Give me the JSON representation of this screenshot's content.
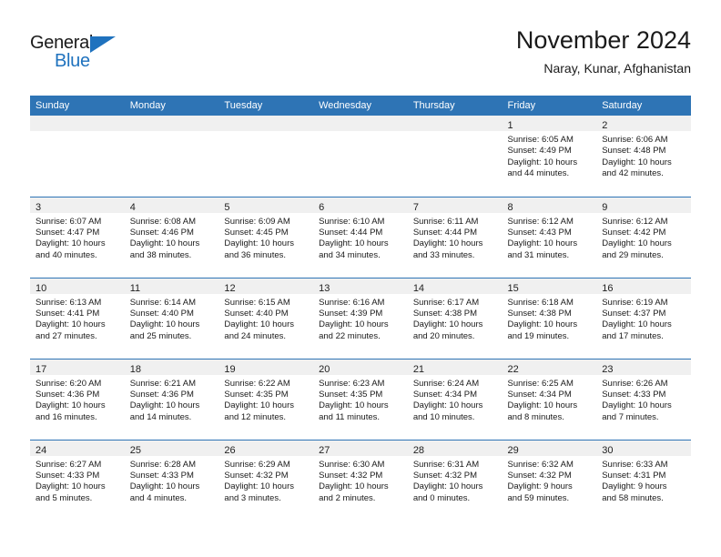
{
  "brand": {
    "name_part1": "General",
    "name_part2": "Blue",
    "accent_color": "#1F72BE",
    "triangle_icon": "triangle-icon"
  },
  "header": {
    "title": "November 2024",
    "subtitle": "Naray, Kunar, Afghanistan"
  },
  "theme": {
    "header_blue": "#2E74B5",
    "daynum_strip_gray": "#F0F0F0"
  },
  "weekday_headers": [
    "Sunday",
    "Monday",
    "Tuesday",
    "Wednesday",
    "Thursday",
    "Friday",
    "Saturday"
  ],
  "weeks": [
    [
      {
        "day": "",
        "lines": []
      },
      {
        "day": "",
        "lines": []
      },
      {
        "day": "",
        "lines": []
      },
      {
        "day": "",
        "lines": []
      },
      {
        "day": "",
        "lines": []
      },
      {
        "day": "1",
        "lines": [
          "Sunrise: 6:05 AM",
          "Sunset: 4:49 PM",
          "Daylight: 10 hours",
          "and 44 minutes."
        ]
      },
      {
        "day": "2",
        "lines": [
          "Sunrise: 6:06 AM",
          "Sunset: 4:48 PM",
          "Daylight: 10 hours",
          "and 42 minutes."
        ]
      }
    ],
    [
      {
        "day": "3",
        "lines": [
          "Sunrise: 6:07 AM",
          "Sunset: 4:47 PM",
          "Daylight: 10 hours",
          "and 40 minutes."
        ]
      },
      {
        "day": "4",
        "lines": [
          "Sunrise: 6:08 AM",
          "Sunset: 4:46 PM",
          "Daylight: 10 hours",
          "and 38 minutes."
        ]
      },
      {
        "day": "5",
        "lines": [
          "Sunrise: 6:09 AM",
          "Sunset: 4:45 PM",
          "Daylight: 10 hours",
          "and 36 minutes."
        ]
      },
      {
        "day": "6",
        "lines": [
          "Sunrise: 6:10 AM",
          "Sunset: 4:44 PM",
          "Daylight: 10 hours",
          "and 34 minutes."
        ]
      },
      {
        "day": "7",
        "lines": [
          "Sunrise: 6:11 AM",
          "Sunset: 4:44 PM",
          "Daylight: 10 hours",
          "and 33 minutes."
        ]
      },
      {
        "day": "8",
        "lines": [
          "Sunrise: 6:12 AM",
          "Sunset: 4:43 PM",
          "Daylight: 10 hours",
          "and 31 minutes."
        ]
      },
      {
        "day": "9",
        "lines": [
          "Sunrise: 6:12 AM",
          "Sunset: 4:42 PM",
          "Daylight: 10 hours",
          "and 29 minutes."
        ]
      }
    ],
    [
      {
        "day": "10",
        "lines": [
          "Sunrise: 6:13 AM",
          "Sunset: 4:41 PM",
          "Daylight: 10 hours",
          "and 27 minutes."
        ]
      },
      {
        "day": "11",
        "lines": [
          "Sunrise: 6:14 AM",
          "Sunset: 4:40 PM",
          "Daylight: 10 hours",
          "and 25 minutes."
        ]
      },
      {
        "day": "12",
        "lines": [
          "Sunrise: 6:15 AM",
          "Sunset: 4:40 PM",
          "Daylight: 10 hours",
          "and 24 minutes."
        ]
      },
      {
        "day": "13",
        "lines": [
          "Sunrise: 6:16 AM",
          "Sunset: 4:39 PM",
          "Daylight: 10 hours",
          "and 22 minutes."
        ]
      },
      {
        "day": "14",
        "lines": [
          "Sunrise: 6:17 AM",
          "Sunset: 4:38 PM",
          "Daylight: 10 hours",
          "and 20 minutes."
        ]
      },
      {
        "day": "15",
        "lines": [
          "Sunrise: 6:18 AM",
          "Sunset: 4:38 PM",
          "Daylight: 10 hours",
          "and 19 minutes."
        ]
      },
      {
        "day": "16",
        "lines": [
          "Sunrise: 6:19 AM",
          "Sunset: 4:37 PM",
          "Daylight: 10 hours",
          "and 17 minutes."
        ]
      }
    ],
    [
      {
        "day": "17",
        "lines": [
          "Sunrise: 6:20 AM",
          "Sunset: 4:36 PM",
          "Daylight: 10 hours",
          "and 16 minutes."
        ]
      },
      {
        "day": "18",
        "lines": [
          "Sunrise: 6:21 AM",
          "Sunset: 4:36 PM",
          "Daylight: 10 hours",
          "and 14 minutes."
        ]
      },
      {
        "day": "19",
        "lines": [
          "Sunrise: 6:22 AM",
          "Sunset: 4:35 PM",
          "Daylight: 10 hours",
          "and 12 minutes."
        ]
      },
      {
        "day": "20",
        "lines": [
          "Sunrise: 6:23 AM",
          "Sunset: 4:35 PM",
          "Daylight: 10 hours",
          "and 11 minutes."
        ]
      },
      {
        "day": "21",
        "lines": [
          "Sunrise: 6:24 AM",
          "Sunset: 4:34 PM",
          "Daylight: 10 hours",
          "and 10 minutes."
        ]
      },
      {
        "day": "22",
        "lines": [
          "Sunrise: 6:25 AM",
          "Sunset: 4:34 PM",
          "Daylight: 10 hours",
          "and 8 minutes."
        ]
      },
      {
        "day": "23",
        "lines": [
          "Sunrise: 6:26 AM",
          "Sunset: 4:33 PM",
          "Daylight: 10 hours",
          "and 7 minutes."
        ]
      }
    ],
    [
      {
        "day": "24",
        "lines": [
          "Sunrise: 6:27 AM",
          "Sunset: 4:33 PM",
          "Daylight: 10 hours",
          "and 5 minutes."
        ]
      },
      {
        "day": "25",
        "lines": [
          "Sunrise: 6:28 AM",
          "Sunset: 4:33 PM",
          "Daylight: 10 hours",
          "and 4 minutes."
        ]
      },
      {
        "day": "26",
        "lines": [
          "Sunrise: 6:29 AM",
          "Sunset: 4:32 PM",
          "Daylight: 10 hours",
          "and 3 minutes."
        ]
      },
      {
        "day": "27",
        "lines": [
          "Sunrise: 6:30 AM",
          "Sunset: 4:32 PM",
          "Daylight: 10 hours",
          "and 2 minutes."
        ]
      },
      {
        "day": "28",
        "lines": [
          "Sunrise: 6:31 AM",
          "Sunset: 4:32 PM",
          "Daylight: 10 hours",
          "and 0 minutes."
        ]
      },
      {
        "day": "29",
        "lines": [
          "Sunrise: 6:32 AM",
          "Sunset: 4:32 PM",
          "Daylight: 9 hours",
          "and 59 minutes."
        ]
      },
      {
        "day": "30",
        "lines": [
          "Sunrise: 6:33 AM",
          "Sunset: 4:31 PM",
          "Daylight: 9 hours",
          "and 58 minutes."
        ]
      }
    ]
  ]
}
